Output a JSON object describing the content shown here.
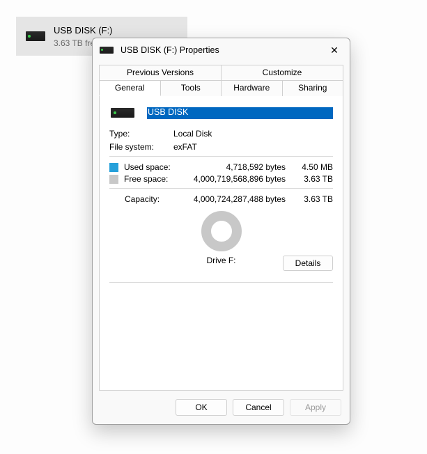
{
  "background_item": {
    "title": "USB DISK (F:)",
    "subtitle": "3.63 TB fre"
  },
  "dialog": {
    "title": "USB DISK (F:) Properties",
    "close_label": "✕",
    "tabs": {
      "row1": [
        "Previous Versions",
        "Customize"
      ],
      "row2": [
        "General",
        "Tools",
        "Hardware",
        "Sharing"
      ],
      "active": "General"
    },
    "volume_name": "USB DISK",
    "type_label": "Type:",
    "type_value": "Local Disk",
    "fs_label": "File system:",
    "fs_value": "exFAT",
    "used_label": "Used space:",
    "used_bytes": "4,718,592 bytes",
    "used_hr": "4.50 MB",
    "free_label": "Free space:",
    "free_bytes": "4,000,719,568,896 bytes",
    "free_hr": "3.63 TB",
    "capacity_label": "Capacity:",
    "capacity_bytes": "4,000,724,287,488 bytes",
    "capacity_hr": "3.63 TB",
    "drive_label": "Drive F:",
    "details_label": "Details",
    "buttons": {
      "ok": "OK",
      "cancel": "Cancel",
      "apply": "Apply"
    }
  },
  "chart_data": {
    "type": "pie",
    "title": "Drive F: space usage",
    "series": [
      {
        "name": "Used space",
        "value_bytes": 4718592,
        "value_human": "4.50 MB",
        "color": "#26a0da"
      },
      {
        "name": "Free space",
        "value_bytes": 4000719568896,
        "value_human": "3.63 TB",
        "color": "#c8c8c8"
      }
    ],
    "total_bytes": 4000724287488,
    "total_human": "3.63 TB"
  }
}
